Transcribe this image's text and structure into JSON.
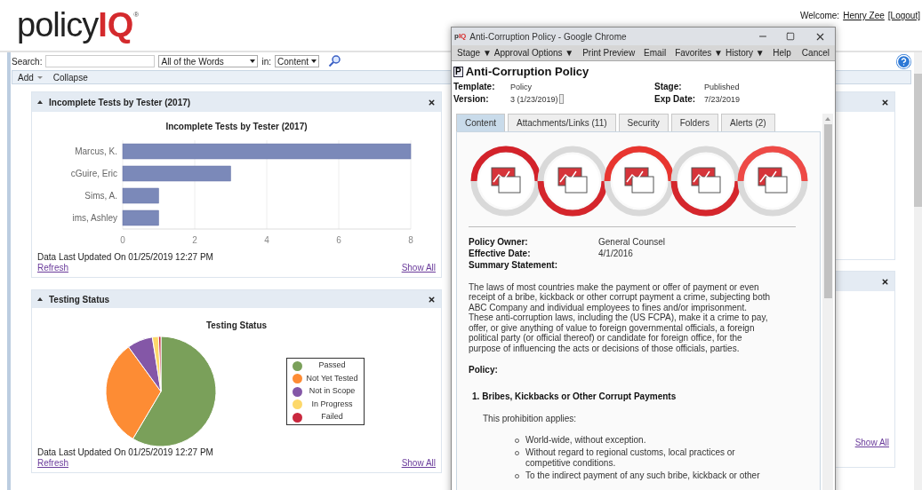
{
  "header": {
    "logo_text": "policy",
    "logo_accent": "IQ",
    "logo_mark": "®",
    "welcome_label": "Welcome:",
    "user_name": "Henry Zee",
    "logout": "[Logout]"
  },
  "search": {
    "label": "Search:",
    "mode": "All of the Words",
    "in_label": "in:",
    "scope": "Content"
  },
  "toolbar": [
    {
      "label": "Add",
      "kind": "menu"
    },
    {
      "label": "Collapse",
      "kind": "button"
    }
  ],
  "widgets": [
    {
      "kind": "bar",
      "title": "Incomplete Tests by Tester (2017)",
      "chart_data": {
        "type": "bar",
        "orientation": "horizontal",
        "title": "Incomplete Tests by Tester (2017)",
        "categories": [
          "Marcus, K.",
          "cGuire, Eric",
          "Sims, A.",
          "ims, Ashley"
        ],
        "values": [
          8,
          3,
          1,
          1
        ],
        "xlim": [
          0,
          8
        ],
        "xticks": [
          0,
          2,
          4,
          6,
          8
        ],
        "grid": true
      },
      "updated": "Data Last Updated On 01/25/2019 12:27 PM",
      "refresh": "Refresh",
      "show_all": "Show All"
    },
    {
      "kind": "pie",
      "title": "Testing Status",
      "chart_title": "Testing Status",
      "legend": [
        {
          "label": "Passed",
          "color": "#7aa05a"
        },
        {
          "label": "Not Yet Tested",
          "color": "#fd8c34"
        },
        {
          "label": "Not in Scope",
          "color": "#8457a7"
        },
        {
          "label": "In Progress",
          "color": "#fdd86a"
        },
        {
          "label": "Failed",
          "color": "#c9283e"
        }
      ],
      "updated": "Data Last Updated On 01/25/2019 12:27 PM",
      "refresh": "Refresh",
      "show_all": "Show All"
    }
  ],
  "right_widgets": [
    {
      "kind": "plain"
    },
    {
      "kind": "footer",
      "show_all": "Show All"
    }
  ],
  "popup": {
    "favicon": [
      "p",
      "IQ"
    ],
    "window_title": "Anti-Corruption Policy - Google Chrome",
    "menu": [
      "Stage ▼",
      "Approval Options ▼",
      "Print Preview",
      "Email",
      "Favorites ▼",
      "History ▼"
    ],
    "menu_right": [
      "Help",
      "Cancel"
    ],
    "doc_icon": "P",
    "doc_title": "Anti-Corruption Policy",
    "fields": [
      {
        "label": "Template:",
        "value": "Policy"
      },
      {
        "label": "Stage:",
        "value": "Published"
      },
      {
        "label": "Version:",
        "value": "3 (1/23/2019)"
      },
      {
        "label": "Exp Date:",
        "value": "7/23/2019"
      }
    ],
    "tabs": [
      {
        "label": "Content",
        "selected": true
      },
      {
        "label": "Attachments/Links (11)",
        "selected": false
      },
      {
        "label": "Security",
        "selected": false
      },
      {
        "label": "Folders",
        "selected": false
      },
      {
        "label": "Alerts (2)",
        "selected": false
      }
    ],
    "details": [
      {
        "label": "Policy Owner:",
        "value": "General Counsel"
      },
      {
        "label": "Effective Date:",
        "value": "4/1/2016"
      },
      {
        "label": "Summary Statement:"
      }
    ],
    "summary": "The laws of most countries make the payment or offer of payment or even receipt of a bribe, kickback or other corrupt payment a crime, subjecting both ABC Company and individual employees to fines and/or imprisonment. These anti-corruption laws, including the (US FCPA), make it a crime to pay, offer, or give anything of value to foreign governmental officials, a foreign political party (or official thereof) or candidate for foreign office, for the purpose of influencing the acts or decisions of those officials, parties.",
    "policy_heading": "Policy:",
    "sections": [
      {
        "number": "1.",
        "title": "Bribes, Kickbacks or Other Corrupt Payments",
        "intro": "This prohibition applies:",
        "bullets": [
          "World-wide, without exception.",
          "Without regard to regional customs, local practices or competitive conditions.",
          "To the indirect payment of any such bribe, kickback or other"
        ]
      }
    ]
  }
}
